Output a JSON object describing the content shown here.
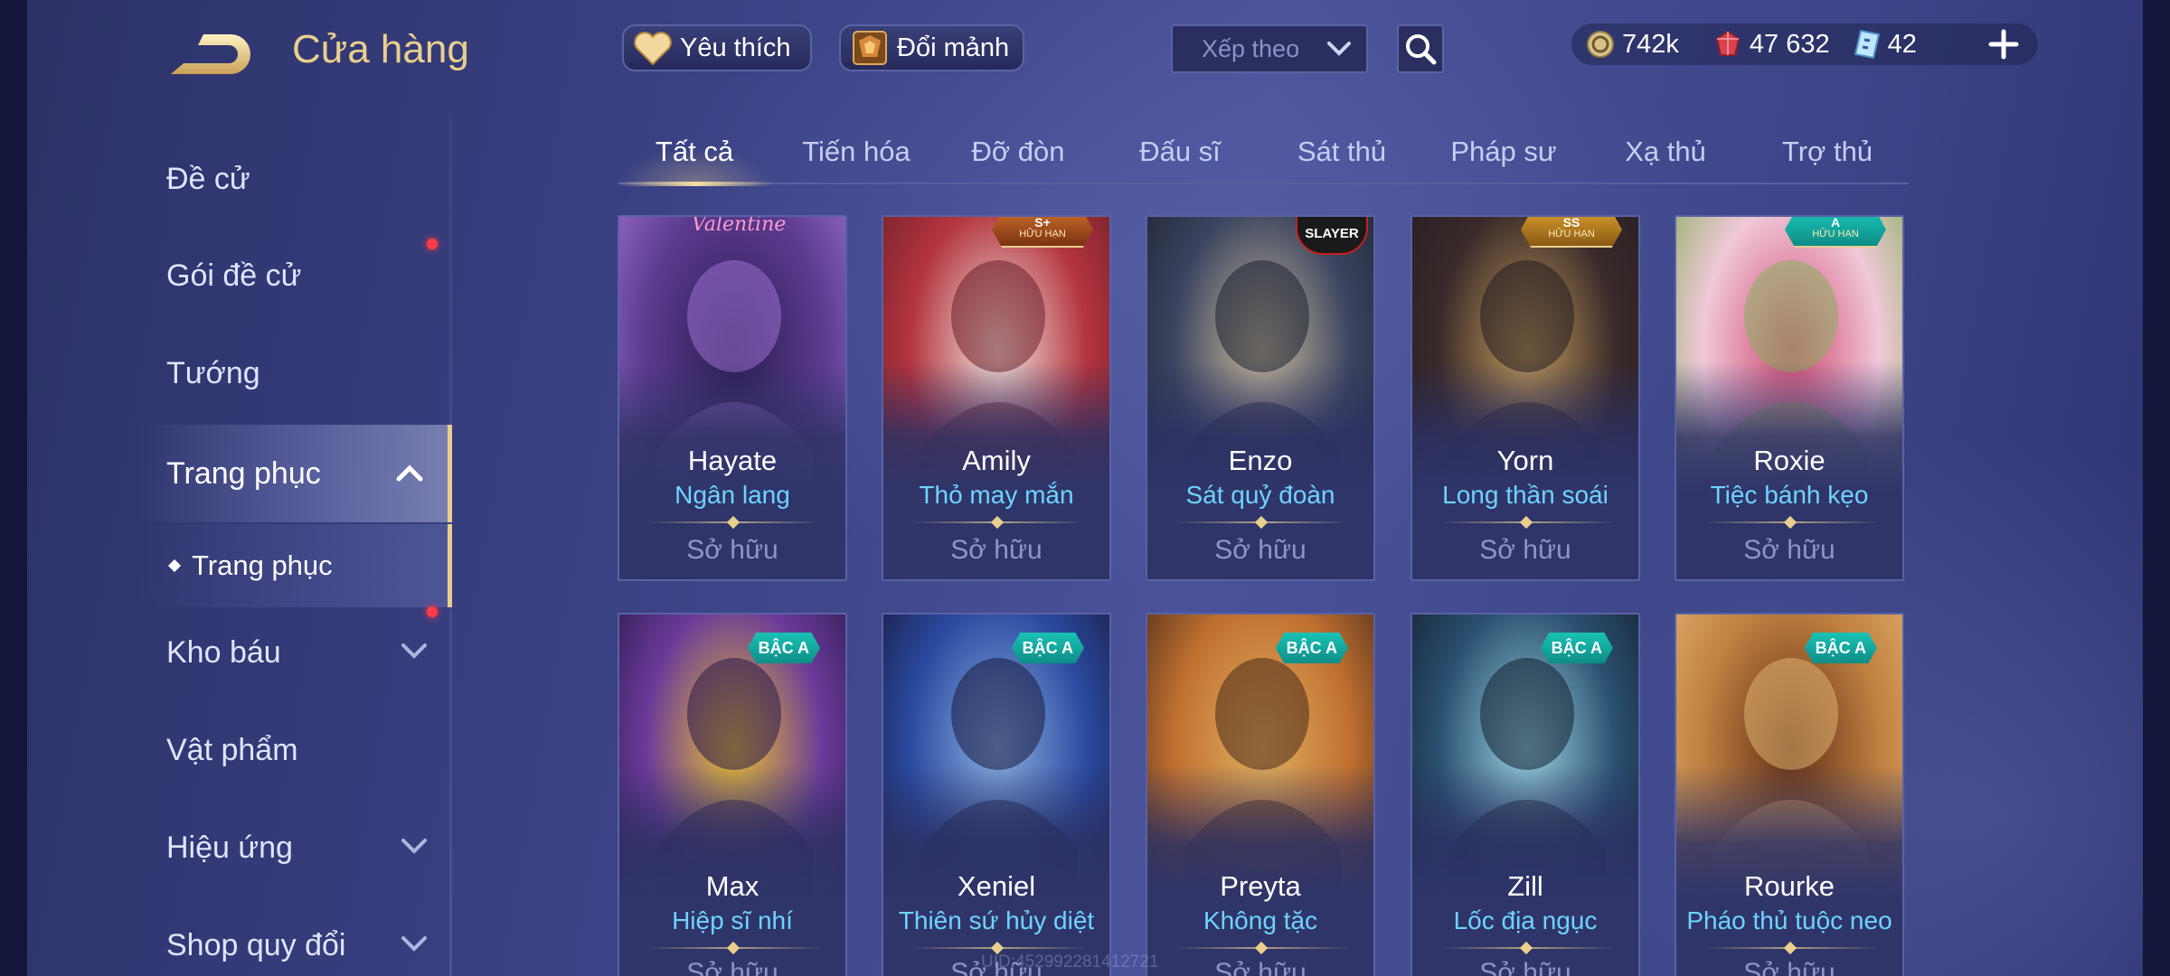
{
  "header": {
    "title": "Cửa hàng",
    "favorite_label": "Yêu thích",
    "shard_label": "Đổi mảnh",
    "sort_placeholder": "Xếp theo",
    "currency": {
      "gold": "742k",
      "gems": "47 632",
      "vouchers": "42"
    }
  },
  "sidebar": {
    "items": [
      {
        "label": "Đề cử",
        "has_dot": false
      },
      {
        "label": "Gói đề cử",
        "has_dot": true
      },
      {
        "label": "Tướng",
        "has_dot": false
      },
      {
        "label": "Trang phục",
        "expanded": true
      },
      {
        "label": "Kho báu",
        "has_dot": true,
        "expandable": true
      },
      {
        "label": "Vật phẩm"
      },
      {
        "label": "Hiệu ứng",
        "expandable": true
      },
      {
        "label": "Shop quy đổi",
        "expandable": true
      }
    ],
    "sub_item": "Trang phục"
  },
  "tabs": [
    "Tất cả",
    "Tiến hóa",
    "Đỡ đòn",
    "Đấu sĩ",
    "Sát thủ",
    "Pháp sư",
    "Xạ thủ",
    "Trợ thủ"
  ],
  "active_tab": "Tất cả",
  "cards": [
    {
      "hero": "Hayate",
      "skin": "Ngân lang",
      "status": "Sở hữu",
      "corner_text": "Valentine",
      "art_colors": [
        "#5b3a8f",
        "#2a1d4f",
        "#9a6fd0"
      ]
    },
    {
      "hero": "Amily",
      "skin": "Thỏ may mắn",
      "status": "Sở hữu",
      "badge_grade": "S+",
      "badge_sub": "HỮU HẠN",
      "art_colors": [
        "#b3343e",
        "#f2e6e0",
        "#6e1f2a"
      ]
    },
    {
      "hero": "Enzo",
      "skin": "Sát quỷ đoàn",
      "status": "Sở hữu",
      "corner_logo": "SLAYER",
      "art_colors": [
        "#3b4560",
        "#c8b89a",
        "#1e2233"
      ]
    },
    {
      "hero": "Yorn",
      "skin": "Long thần soái",
      "status": "Sở hữu",
      "badge_grade": "SS",
      "badge_sub": "HỮU HẠN",
      "art_colors": [
        "#3a2a2a",
        "#c09a5a",
        "#241c22"
      ]
    },
    {
      "hero": "Roxie",
      "skin": "Tiệc bánh kẹo",
      "status": "Sở hữu",
      "badge_grade": "A",
      "badge_sub": "HỮU HẠN",
      "art_colors": [
        "#f0c8d8",
        "#d04a72",
        "#8ab060"
      ]
    },
    {
      "hero": "Max",
      "skin": "Hiệp sĩ nhí",
      "status": "Sở hữu",
      "badge": "BẬC A",
      "art_colors": [
        "#6b3a9a",
        "#e8c030",
        "#2a1a4a"
      ]
    },
    {
      "hero": "Xeniel",
      "skin": "Thiên sứ hủy diệt",
      "status": "Sở hữu",
      "badge": "BẬC A",
      "art_colors": [
        "#2a4aa0",
        "#8ab0e0",
        "#1a1a40"
      ]
    },
    {
      "hero": "Preyta",
      "skin": "Không tặc",
      "status": "Sở hữu",
      "badge": "BẬC A",
      "art_colors": [
        "#c07030",
        "#e0b060",
        "#4a2a1a"
      ]
    },
    {
      "hero": "Zill",
      "skin": "Lốc địa ngục",
      "status": "Sở hữu",
      "badge": "BẬC A",
      "art_colors": [
        "#2a5070",
        "#9ad0e0",
        "#142030"
      ]
    },
    {
      "hero": "Rourke",
      "skin": "Pháo thủ tuộc neo",
      "status": "Sở hữu",
      "badge": "BẬC A",
      "art_colors": [
        "#c08040",
        "#603018",
        "#e0b070"
      ]
    }
  ],
  "watermark": "UID:452992281412721",
  "colors": {
    "accent_gold": "#e9cf8e",
    "skin_name": "#6fd3ff",
    "notify_dot": "#ff3b47",
    "tier_badge": "#1ac2b5"
  }
}
